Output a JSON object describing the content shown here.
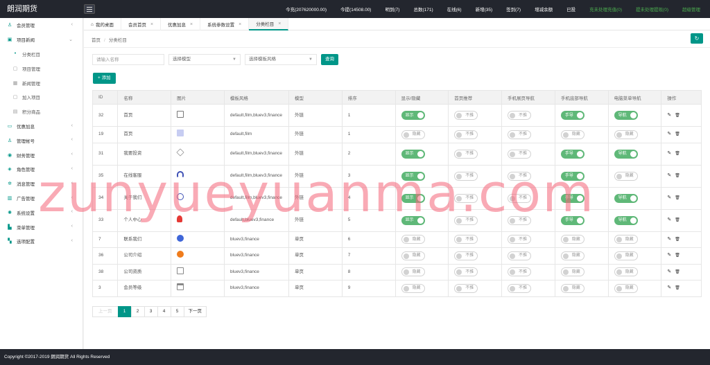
{
  "header": {
    "brand": "朗润期货",
    "nav": [
      {
        "label": "今充(207620000.00)",
        "color": ""
      },
      {
        "label": "今提(14508.00)",
        "color": ""
      },
      {
        "label": "明到(7)",
        "color": ""
      },
      {
        "label": "总数(171)",
        "color": ""
      },
      {
        "label": "在线(6)",
        "color": ""
      },
      {
        "label": "新增(35)",
        "color": ""
      },
      {
        "label": "签到(7)",
        "color": ""
      },
      {
        "label": "增减余额",
        "color": ""
      },
      {
        "label": "已投",
        "color": ""
      },
      {
        "label": "充未处理充值(0)",
        "color": "green"
      },
      {
        "label": "提未处理提现(0)",
        "color": "green"
      },
      {
        "label": "超级管理",
        "color": "green"
      }
    ]
  },
  "sidebar": {
    "items": [
      {
        "label": "会员管理",
        "icon": "user-icon",
        "glyph": "♙",
        "arrow": "‹",
        "sub": false
      },
      {
        "label": "项目新闻",
        "icon": "car-icon",
        "glyph": "▣",
        "arrow": "⌄",
        "sub": false
      },
      {
        "label": "分类栏目",
        "icon": "bullet-icon",
        "glyph": "•",
        "arrow": "",
        "sub": true,
        "active": true
      },
      {
        "label": "项目管理",
        "icon": "cart-icon",
        "glyph": "▢",
        "arrow": "",
        "sub": true
      },
      {
        "label": "新闻管理",
        "icon": "grid-icon",
        "glyph": "▦",
        "arrow": "",
        "sub": true
      },
      {
        "label": "加入项目",
        "icon": "cart-icon",
        "glyph": "▢",
        "arrow": "",
        "sub": true
      },
      {
        "label": "积分商品",
        "icon": "gift-icon",
        "glyph": "▤",
        "arrow": "",
        "sub": true
      },
      {
        "label": "优惠加息",
        "icon": "ticket-icon",
        "glyph": "▭",
        "arrow": "‹",
        "sub": false
      },
      {
        "label": "管理帐号",
        "icon": "admin-icon",
        "glyph": "♙",
        "arrow": "‹",
        "sub": false
      },
      {
        "label": "财务管理",
        "icon": "finance-icon",
        "glyph": "◉",
        "arrow": "‹",
        "sub": false
      },
      {
        "label": "角色管理",
        "icon": "shield-icon",
        "glyph": "◈",
        "arrow": "‹",
        "sub": false
      },
      {
        "label": "消息管理",
        "icon": "bell-icon",
        "glyph": "✲",
        "arrow": "‹",
        "sub": false
      },
      {
        "label": "广告管理",
        "icon": "ad-icon",
        "glyph": "▥",
        "arrow": "‹",
        "sub": false
      },
      {
        "label": "系统设置",
        "icon": "gear-icon",
        "glyph": "✺",
        "arrow": "‹",
        "sub": false
      },
      {
        "label": "菜单管理",
        "icon": "menu-icon",
        "glyph": "▙",
        "arrow": "‹",
        "sub": false
      },
      {
        "label": "选项配置",
        "icon": "options-icon",
        "glyph": "▚",
        "arrow": "‹",
        "sub": false
      }
    ]
  },
  "tabs": [
    {
      "label": "我的桌面",
      "home": true,
      "close": false
    },
    {
      "label": "会员首页",
      "close": true
    },
    {
      "label": "优惠加息",
      "close": true
    },
    {
      "label": "系统参数设置",
      "close": true
    },
    {
      "label": "分类栏目",
      "close": true,
      "active": true
    }
  ],
  "breadcrumb": {
    "home": "首页",
    "sep": "/",
    "current": "分类栏目"
  },
  "filter": {
    "name_placeholder": "请输入名称",
    "model_select": "选择模型",
    "style_select": "选择模板风格",
    "query_label": "查询"
  },
  "add_label": "+ 添加",
  "table": {
    "headers": [
      "ID",
      "名称",
      "图片",
      "模板风格",
      "模型",
      "排序",
      "显示/隐藏",
      "首页推荐",
      "手机展页导航",
      "手机底部导航",
      "电脑菜单导航",
      "操作"
    ],
    "rows": [
      {
        "id": "32",
        "name": "首页",
        "img": "sq",
        "style": "default,film,bluev3,finance",
        "model": "外链",
        "sort": "1",
        "show": [
          "on",
          "显示"
        ],
        "rec": [
          "off",
          "不推"
        ],
        "mnav": [
          "off",
          "不推"
        ],
        "mbot": [
          "on",
          "手导"
        ],
        "pcnav": [
          "on",
          "导航"
        ],
        "tall": true
      },
      {
        "id": "19",
        "name": "首页",
        "img": "pale",
        "style": "default,film",
        "model": "外链",
        "sort": "1",
        "show": [
          "off",
          "隐藏"
        ],
        "rec": [
          "off",
          "不推"
        ],
        "mnav": [
          "off",
          "不推"
        ],
        "mbot": [
          "off",
          "隐藏"
        ],
        "pcnav": [
          "off",
          "隐藏"
        ],
        "tall": false
      },
      {
        "id": "31",
        "name": "我要投资",
        "img": "stack",
        "style": "default,film,bluev3,finance",
        "model": "外链",
        "sort": "2",
        "show": [
          "on",
          "显示"
        ],
        "rec": [
          "off",
          "不推"
        ],
        "mnav": [
          "off",
          "不推"
        ],
        "mbot": [
          "on",
          "手导"
        ],
        "pcnav": [
          "on",
          "导航"
        ],
        "tall": true
      },
      {
        "id": "35",
        "name": "在线客服",
        "img": "head",
        "style": "default,film,bluev3,finance",
        "model": "外链",
        "sort": "3",
        "show": [
          "on",
          "显示"
        ],
        "rec": [
          "off",
          "不推"
        ],
        "mnav": [
          "off",
          "不推"
        ],
        "mbot": [
          "on",
          "手导"
        ],
        "pcnav": [
          "off",
          "隐藏"
        ],
        "tall": true
      },
      {
        "id": "34",
        "name": "关于我们",
        "img": "compass",
        "style": "default,film,bluev3,finance",
        "model": "外链",
        "sort": "4",
        "show": [
          "on",
          "显示"
        ],
        "rec": [
          "off",
          "不推"
        ],
        "mnav": [
          "off",
          "不推"
        ],
        "mbot": [
          "on",
          "手导"
        ],
        "pcnav": [
          "on",
          "导航"
        ],
        "tall": true
      },
      {
        "id": "33",
        "name": "个人中心",
        "img": "user",
        "style": "default,bluev3,finance",
        "model": "外链",
        "sort": "5",
        "show": [
          "on",
          "显示"
        ],
        "rec": [
          "off",
          "不推"
        ],
        "mnav": [
          "off",
          "不推"
        ],
        "mbot": [
          "on",
          "手导"
        ],
        "pcnav": [
          "on",
          "导航"
        ],
        "tall": true
      },
      {
        "id": "7",
        "name": "联系我们",
        "img": "blue",
        "style": "bluev3,finance",
        "model": "单页",
        "sort": "6",
        "show": [
          "off",
          "隐藏"
        ],
        "rec": [
          "off",
          "不推"
        ],
        "mnav": [
          "off",
          "不推"
        ],
        "mbot": [
          "off",
          "隐藏"
        ],
        "pcnav": [
          "off",
          "隐藏"
        ],
        "tall": false
      },
      {
        "id": "36",
        "name": "公司介绍",
        "img": "orange",
        "style": "bluev3,finance",
        "model": "单页",
        "sort": "7",
        "show": [
          "off",
          "隐藏"
        ],
        "rec": [
          "off",
          "不推"
        ],
        "mnav": [
          "off",
          "不推"
        ],
        "mbot": [
          "off",
          "隐藏"
        ],
        "pcnav": [
          "off",
          "隐藏"
        ],
        "tall": false
      },
      {
        "id": "38",
        "name": "公司资质",
        "img": "box",
        "style": "bluev3,finance",
        "model": "单页",
        "sort": "8",
        "show": [
          "off",
          "隐藏"
        ],
        "rec": [
          "off",
          "不推"
        ],
        "mnav": [
          "off",
          "不推"
        ],
        "mbot": [
          "off",
          "隐藏"
        ],
        "pcnav": [
          "off",
          "隐藏"
        ],
        "tall": false
      },
      {
        "id": "3",
        "name": "会员等级",
        "img": "hat",
        "style": "bluev3,finance",
        "model": "单页",
        "sort": "9",
        "show": [
          "off",
          "隐藏"
        ],
        "rec": [
          "off",
          "不推"
        ],
        "mnav": [
          "off",
          "不推"
        ],
        "mbot": [
          "off",
          "隐藏"
        ],
        "pcnav": [
          "off",
          "隐藏"
        ],
        "tall": false
      }
    ]
  },
  "pager": {
    "prev": "上一页",
    "pages": [
      "1",
      "2",
      "3",
      "4",
      "5"
    ],
    "current": "1",
    "next": "下一页"
  },
  "footer": "Copyright ©2017-2019 朗润期货 All Rights Reserved",
  "watermark": "zunyueyuanma.com",
  "colors": {
    "accent": "#009688",
    "switch_on": "#5fb878",
    "header_bg": "#23262e"
  }
}
